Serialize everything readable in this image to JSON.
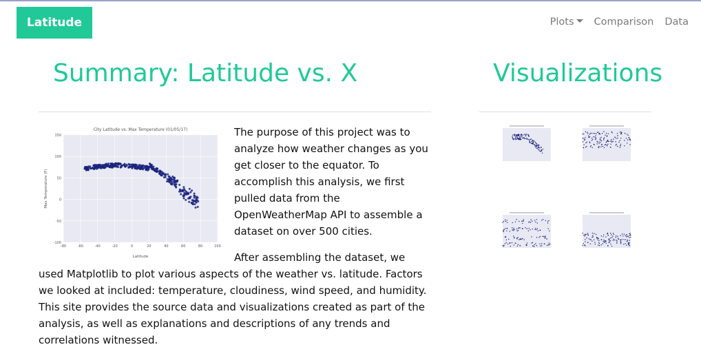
{
  "navbar": {
    "brand": "Latitude",
    "items": [
      {
        "label": "Plots",
        "dropdown": true
      },
      {
        "label": "Comparison"
      },
      {
        "label": "Data"
      }
    ]
  },
  "summary": {
    "heading": "Summary: Latitude vs. X",
    "paragraphs": [
      "The purpose of this project was to analyze how weather changes as you get closer to the equator. To accomplish this analysis, we first pulled data from the OpenWeatherMap API to assemble a dataset on over 500 cities.",
      "After assembling the dataset, we used Matplotlib to plot various aspects of the weather vs. latitude. Factors we looked at included: temperature, cloudiness, wind speed, and humidity. This site provides the source data and visualizations created as part of the analysis, as well as explanations and descriptions of any trends and correlations witnessed."
    ]
  },
  "visualizations": {
    "heading": "Visualizations",
    "thumbnails": [
      {
        "kind": "temperature"
      },
      {
        "kind": "humidity"
      },
      {
        "kind": "cloudiness"
      },
      {
        "kind": "wind"
      }
    ]
  },
  "colors": {
    "accent": "#20c997",
    "nav_text": "#7b7b7b",
    "point": "#1a237e",
    "plot_bg": "#e8e9f2"
  },
  "chart_data": {
    "type": "scatter",
    "title": "City Latitude vs. Max Temperature (01/05/17)",
    "xlabel": "Latitude",
    "ylabel": "Max Temperature (F)",
    "xlim": [
      -80,
      100
    ],
    "ylim": [
      -100,
      150
    ],
    "x_ticks": [
      "-80",
      "-60",
      "-40",
      "-20",
      "0",
      "20",
      "40",
      "60",
      "80",
      "100"
    ],
    "y_ticks": [
      "-100",
      "-50",
      "0",
      "50",
      "100",
      "150"
    ],
    "grid": true
  }
}
